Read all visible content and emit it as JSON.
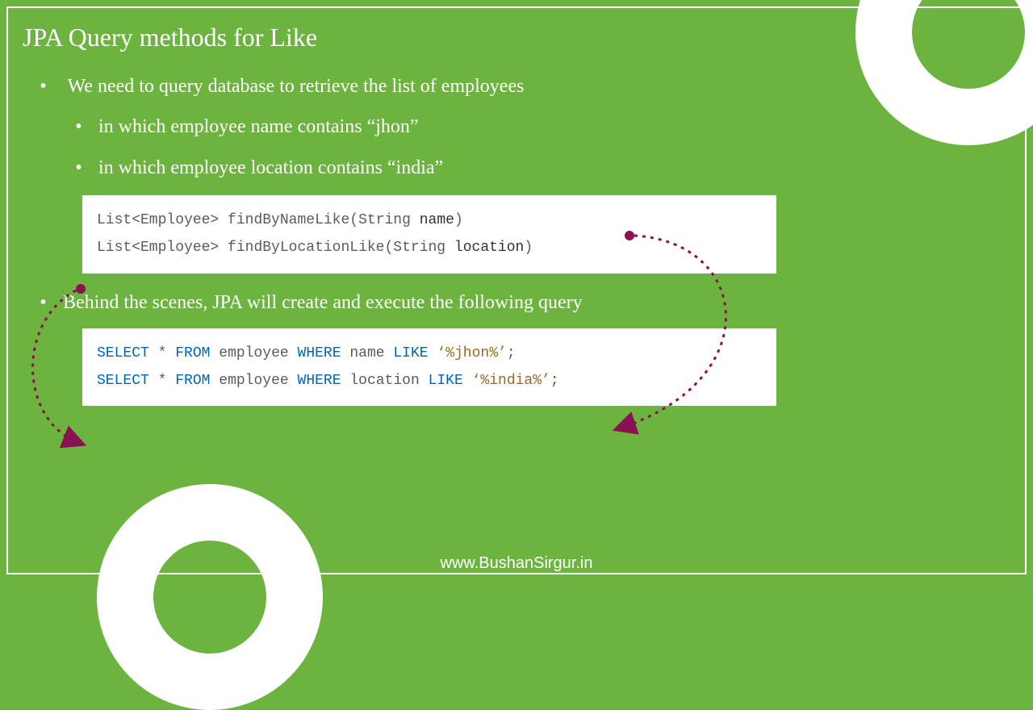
{
  "title": "JPA Query methods for Like",
  "bullets": {
    "b1": "We need to query database to retrieve the list of employees",
    "s1": "in which employee name contains “jhon”",
    "s2": "in which employee location contains “india”",
    "b2": "Behind the scenes, JPA will create and execute the following query"
  },
  "java": {
    "line1": {
      "ret": "List<Employee>",
      "method": "findByNameLike",
      "ptype": "String",
      "pname": "name"
    },
    "line2": {
      "ret": "List<Employee>",
      "method": "findByLocationLike",
      "ptype": "String",
      "pname": "location"
    }
  },
  "sql": {
    "line1": {
      "select": "SELECT",
      "star": "*",
      "from": "FROM",
      "table": "employee",
      "where": "WHERE",
      "col": "name",
      "like": "LIKE",
      "val": "‘%jhon%’",
      "semi": ";"
    },
    "line2": {
      "select": "SELECT",
      "star": "*",
      "from": "FROM",
      "table": "employee",
      "where": "WHERE",
      "col": "location",
      "like": "LIKE",
      "val": "‘%india%’",
      "semi": ";"
    }
  },
  "footer": "www.BushanSirgur.in",
  "colors": {
    "accent": "#8a1253"
  }
}
